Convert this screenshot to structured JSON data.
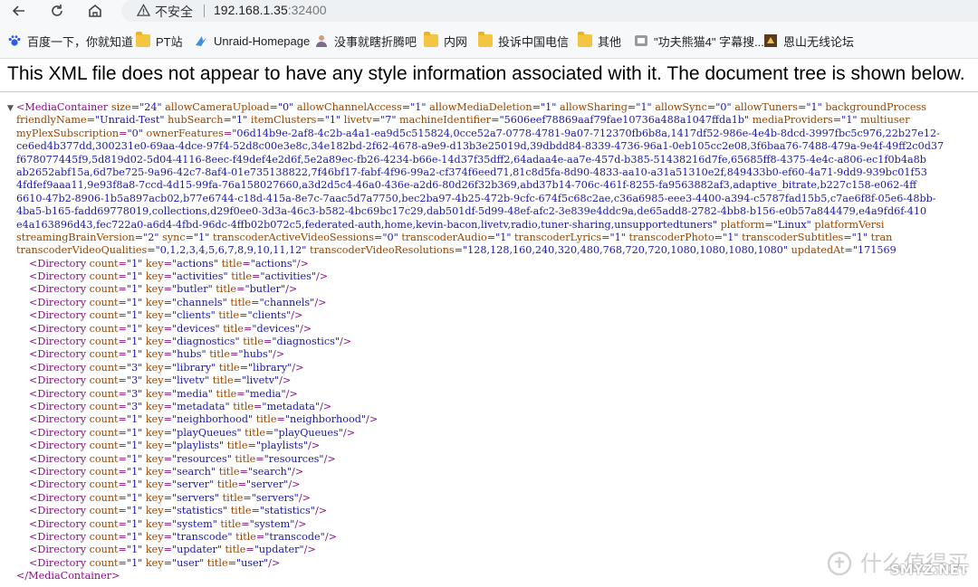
{
  "browser": {
    "security_label": "不安全",
    "url_host": "192.168.1.35",
    "url_port": ":32400"
  },
  "bookmarks": [
    {
      "label": "百度一下，你就知道",
      "icon": "baidu-paw-icon"
    },
    {
      "label": "PT站",
      "icon": "folder-icon"
    },
    {
      "label": "Unraid-Homepage",
      "icon": "unraid-icon"
    },
    {
      "label": "没事就瞎折腾吧",
      "icon": "site-icon"
    },
    {
      "label": "内网",
      "icon": "folder-icon"
    },
    {
      "label": "投诉中国电信",
      "icon": "folder-icon"
    },
    {
      "label": "其他",
      "icon": "folder-icon"
    },
    {
      "label": "\"功夫熊猫4\" 字幕搜...",
      "icon": "subtitle-site-icon"
    },
    {
      "label": "恩山无线论坛",
      "icon": "forum-icon"
    }
  ],
  "notice": "This XML file does not appear to have any style information associated with it. The document tree is shown below.",
  "root": {
    "attrs_line1": [
      [
        "size",
        "24"
      ],
      [
        "allowCameraUpload",
        "0"
      ],
      [
        "allowChannelAccess",
        "1"
      ],
      [
        "allowMediaDeletion",
        "1"
      ],
      [
        "allowSharing",
        "1"
      ],
      [
        "allowSync",
        "0"
      ],
      [
        "allowTuners",
        "1"
      ],
      [
        "backgroundProcess",
        ""
      ]
    ],
    "wrapped_lines": [
      "friendlyName=\"Unraid-Test\" hubSearch=\"1\" itemClusters=\"1\" livetv=\"7\" machineIdentifier=\"5606eef78869aaf79fae10736a488a1047ffda1b\" mediaProviders=\"1\" multiuser",
      "myPlexSubscription=\"0\" ownerFeatures=\"06d14b9e-2af8-4c2b-a4a1-ea9d5c515824,0cce52a7-0778-4781-9a07-712370fb6b8a,1417df52-986e-4e4b-8dcd-3997fbc5c976,22b27e12-",
      "ce6ed4b377dd,300231e0-69aa-4dce-97f4-52d8c00e3e8c,34e182bd-2f62-4678-a9e9-d13b3e25019d,39dbdd84-8339-4736-96a1-0eb105cc2e08,3f6baa76-7488-479a-9e4f-49ff2c0d37",
      "f678077445f9,5d819d02-5d04-4116-8eec-f49def4e2d6f,5e2a89ec-fb26-4234-b66e-14d37f35dff2,64adaa4e-aa7e-457d-b385-51438216d7fe,65685ff8-4375-4e4c-a806-ec1f0b4a8b",
      "ab2652abf15a,6d7be725-9a96-42c7-8af4-01e735138822,7f46bf17-fabf-4f96-99a2-cf374f6eed71,81c8d5fa-8d90-4833-aa10-a31a51310e2f,849433b0-ef60-4a71-9dd9-939bc01f53",
      "4fdfef9aaa11,9e93f8a8-7ccd-4d15-99fa-76a158027660,a3d2d5c4-46a0-436e-a2d6-80d26f32b369,abd37b14-706c-461f-8255-fa9563882af3,adaptive_bitrate,b227c158-e062-4ff",
      "6610-47b2-8906-1b5a897acb02,b77e6744-c18d-415a-8e7c-7aac5d7a7750,bec2ba97-4b25-472b-9cfc-674f5c68c2ae,c36a6985-eee3-4400-a394-c5787fad15b5,c7ae6f8f-05e6-48bb-",
      "4ba5-b165-fadd69778019,collections,d29f0ee0-3d3a-46c3-b582-4bc69bc17c29,dab501df-5d99-48ef-afc2-3e839e4ddc9a,de65add8-2782-4bb8-b156-e0b57a844479,e4a9fd6f-410",
      "e4a163896d43,fec722a0-a6d4-4fbd-96dc-4ffb02b072c5,federated-auth,home,kevin-bacon,livetv,radio,tuner-sharing,unsupportedtuners\" platform=\"Linux\" platformVersi",
      "streamingBrainVersion=\"2\" sync=\"1\" transcoderActiveVideoSessions=\"0\" transcoderAudio=\"1\" transcoderLyrics=\"1\" transcoderPhoto=\"1\" transcoderSubtitles=\"1\" tran",
      "transcoderVideoQualities=\"0,1,2,3,4,5,6,7,8,9,10,11,12\" transcoderVideoResolutions=\"128,128,160,240,320,480,768,720,720,1080,1080,1080,1080\" updatedAt=\"171569"
    ],
    "directories": [
      {
        "count": "1",
        "key": "actions",
        "title": "actions"
      },
      {
        "count": "1",
        "key": "activities",
        "title": "activities"
      },
      {
        "count": "1",
        "key": "butler",
        "title": "butler"
      },
      {
        "count": "1",
        "key": "channels",
        "title": "channels"
      },
      {
        "count": "1",
        "key": "clients",
        "title": "clients"
      },
      {
        "count": "1",
        "key": "devices",
        "title": "devices"
      },
      {
        "count": "1",
        "key": "diagnostics",
        "title": "diagnostics"
      },
      {
        "count": "1",
        "key": "hubs",
        "title": "hubs"
      },
      {
        "count": "3",
        "key": "library",
        "title": "library"
      },
      {
        "count": "3",
        "key": "livetv",
        "title": "livetv"
      },
      {
        "count": "3",
        "key": "media",
        "title": "media"
      },
      {
        "count": "3",
        "key": "metadata",
        "title": "metadata"
      },
      {
        "count": "1",
        "key": "neighborhood",
        "title": "neighborhood"
      },
      {
        "count": "1",
        "key": "playQueues",
        "title": "playQueues"
      },
      {
        "count": "1",
        "key": "playlists",
        "title": "playlists"
      },
      {
        "count": "1",
        "key": "resources",
        "title": "resources"
      },
      {
        "count": "1",
        "key": "search",
        "title": "search"
      },
      {
        "count": "1",
        "key": "server",
        "title": "server"
      },
      {
        "count": "1",
        "key": "servers",
        "title": "servers"
      },
      {
        "count": "1",
        "key": "statistics",
        "title": "statistics"
      },
      {
        "count": "1",
        "key": "system",
        "title": "system"
      },
      {
        "count": "1",
        "key": "transcode",
        "title": "transcode"
      },
      {
        "count": "1",
        "key": "updater",
        "title": "updater"
      },
      {
        "count": "1",
        "key": "user",
        "title": "user"
      }
    ],
    "close_tag": "</MediaContainer>"
  },
  "watermark": {
    "text": "什么值得买",
    "site": "SMYZ.NET"
  }
}
